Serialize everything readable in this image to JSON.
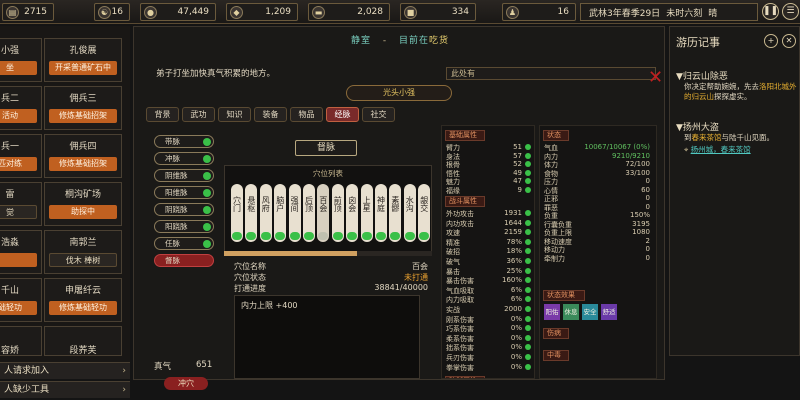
{
  "topbar": {
    "resources": [
      {
        "icon": "scroll-icon",
        "glyph": "▤",
        "value": "2715"
      },
      {
        "icon": "yinyang-icon",
        "glyph": "☯",
        "value": "16"
      },
      {
        "icon": "coin-icon",
        "glyph": "●",
        "value": "47,449"
      },
      {
        "icon": "gem-icon",
        "glyph": "◆",
        "value": "1,209"
      },
      {
        "icon": "ingot-icon",
        "glyph": "▬",
        "value": "2,028"
      },
      {
        "icon": "stone-icon",
        "glyph": "■",
        "value": "334"
      },
      {
        "icon": "figure-icon",
        "glyph": "♟",
        "value": "16"
      }
    ],
    "date": "武林3年春季29日",
    "time": "未时六刻",
    "weather": "晴",
    "pause_icon": "pause-icon",
    "menu_icon": "menu-icon"
  },
  "roster": {
    "cards": [
      {
        "name": "小强",
        "tag": "坐",
        "col": 0
      },
      {
        "name": "孔俊展",
        "tag": "开采普通矿石中",
        "col": 1
      },
      {
        "name": "兵二",
        "tag": "活动",
        "col": 0
      },
      {
        "name": "佣兵三",
        "tag": "修炼基础招架",
        "col": 1
      },
      {
        "name": "兵一",
        "tag": "匹对练",
        "col": 0
      },
      {
        "name": "佣兵四",
        "tag": "修炼基础招架",
        "col": 1
      },
      {
        "name": "雷",
        "tag": "觉",
        "col": 0
      },
      {
        "name": "桐沟矿场",
        "tag": "助探中",
        "col": 1
      },
      {
        "name": "浩淼",
        "tag": "",
        "col": 0
      },
      {
        "name": "南郭兰",
        "tag": "伐木 棒树",
        "col": 1
      },
      {
        "name": "千山",
        "tag": "础轻功",
        "col": 0
      },
      {
        "name": "申屠纤云",
        "tag": "修炼基础轻功",
        "col": 1
      },
      {
        "name": "容娇",
        "tag": "",
        "col": 0
      },
      {
        "name": "段荞芙",
        "tag": "",
        "col": 1
      }
    ],
    "footer": "备注",
    "bottom_rows": [
      "人请求加入",
      "人缺少工具"
    ]
  },
  "main": {
    "place": "静室",
    "dash": "-",
    "location_prefix": "目前在",
    "location": "吃货",
    "description": "弟子打坐加快真气积累的地方。",
    "event_box": "此处有",
    "character_name": "光头小强",
    "tabs": [
      "背景",
      "武功",
      "知识",
      "装备",
      "物品",
      "经脉",
      "社交"
    ],
    "active_tab": 5,
    "meridians": [
      "带脉",
      "冲脉",
      "阴维脉",
      "阳维脉",
      "阴跷脉",
      "阳跷脉",
      "任脉",
      "督脉"
    ],
    "meridian_done": [
      true,
      true,
      true,
      true,
      true,
      true,
      true,
      false
    ],
    "zhenqi_label": "真气",
    "zhenqi_value": "651",
    "chongxue_button": "冲穴",
    "dumai_title": "督脉",
    "acupoint_header": "穴位列表",
    "acupoints": [
      "穴门",
      "悬枢",
      "风府",
      "脑户",
      "强间",
      "后顶",
      "百会",
      "前顶",
      "囟会",
      "上星",
      "神庭",
      "素髎",
      "水沟",
      "龈交"
    ],
    "acupoint_progress": 0.64,
    "acu_info": [
      {
        "label": "穴位名称",
        "value": "百会"
      },
      {
        "label": "穴位状态",
        "value": "未打通"
      },
      {
        "label": "打通进度",
        "value": "38841/40000"
      }
    ],
    "effect_text": "内力上限 +400"
  },
  "stats": {
    "base_title": "基础属性",
    "base": [
      {
        "l": "臂力",
        "v": "51"
      },
      {
        "l": "身法",
        "v": "57"
      },
      {
        "l": "根骨",
        "v": "52"
      },
      {
        "l": "悟性",
        "v": "49"
      },
      {
        "l": "魅力",
        "v": "47"
      },
      {
        "l": "福缘",
        "v": "9"
      }
    ],
    "combat_title": "战斗属性",
    "combat": [
      {
        "l": "外功攻击",
        "v": "1931"
      },
      {
        "l": "内功攻击",
        "v": "1644"
      },
      {
        "l": "攻速",
        "v": "2159"
      },
      {
        "l": "精准",
        "v": "78%"
      },
      {
        "l": "破招",
        "v": "18%"
      },
      {
        "l": "破气",
        "v": "36%"
      },
      {
        "l": "暴击",
        "v": "25%"
      },
      {
        "l": "暴击伤害",
        "v": "160%"
      },
      {
        "l": "气血吸取",
        "v": "6%"
      },
      {
        "l": "内力吸取",
        "v": "6%"
      },
      {
        "l": "实战",
        "v": "2000"
      },
      {
        "l": "刚系伤害",
        "v": "0%"
      },
      {
        "l": "巧系伤害",
        "v": "0%"
      },
      {
        "l": "柔系伤害",
        "v": "0%"
      },
      {
        "l": "拙系伤害",
        "v": "0%"
      },
      {
        "l": "兵刃伤害",
        "v": "0%"
      },
      {
        "l": "拳掌伤害",
        "v": "0%"
      }
    ],
    "defense_title": "防御属性",
    "defense": [
      {
        "l": "外功防御",
        "v": "1858"
      }
    ],
    "state_title": "状态",
    "state": [
      {
        "l": "气血",
        "v": "10067/10067 (0%)",
        "g": true
      },
      {
        "l": "内力",
        "v": "9210/9210",
        "g": true
      },
      {
        "l": "体力",
        "v": "72/100"
      },
      {
        "l": "食物",
        "v": "33/100"
      },
      {
        "l": "压力",
        "v": "0"
      },
      {
        "l": "心情",
        "v": "60"
      },
      {
        "l": "正邪",
        "v": "0"
      },
      {
        "l": "罪恶",
        "v": "0"
      },
      {
        "l": "负重",
        "v": "150%"
      },
      {
        "l": "行囊负重",
        "v": "3195"
      },
      {
        "l": "负重上限",
        "v": "1080"
      },
      {
        "l": "移动速度",
        "v": "2"
      },
      {
        "l": "移动力",
        "v": "0"
      },
      {
        "l": "牵制力",
        "v": "0"
      }
    ],
    "state_effect_title": "状态效果",
    "state_effects": [
      {
        "label": "阳佑",
        "color": "#7a3aa8"
      },
      {
        "label": "休息",
        "color": "#3a8a5a"
      },
      {
        "label": "安全",
        "color": "#2a8a9a"
      },
      {
        "label": "舒适",
        "color": "#6a3aa8"
      }
    ],
    "injury_title": "伤病",
    "poison_title": "中毒"
  },
  "journal": {
    "title": "游历记事",
    "add_icon": "add-circle-icon",
    "close_icon": "close-circle-icon",
    "entries": [
      {
        "head": "归云山除恶",
        "body_pre": "你决定帮助婉婉，先去",
        "body_link": "洛阳北城外的归云山",
        "body_post": "探探虚实。"
      },
      {
        "head": "扬州大盗",
        "body_pre": "到",
        "body_link": "春来茶馆",
        "body_post": "与陆千山见面。",
        "sub_link": "扬州城，春来茶馆"
      }
    ]
  }
}
